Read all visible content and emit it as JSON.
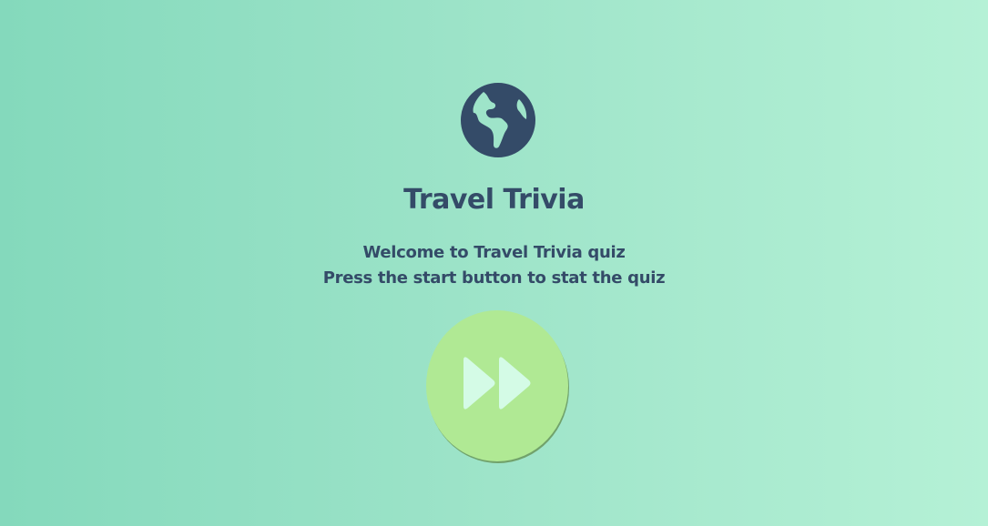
{
  "app": {
    "logo_icon": "globe-icon",
    "title": "Travel Trivia"
  },
  "intro": {
    "line1": "Welcome to Travel Trivia quiz",
    "line2": "Press the start button to stat the quiz"
  },
  "start_button": {
    "icon": "fast-forward-icon",
    "color": "#b0e994"
  },
  "colors": {
    "text": "#344b68",
    "background_start": "#84d9bc",
    "background_end": "#b5f1d6",
    "button_fill": "#b0e994",
    "button_icon": "#d4fbe6"
  }
}
